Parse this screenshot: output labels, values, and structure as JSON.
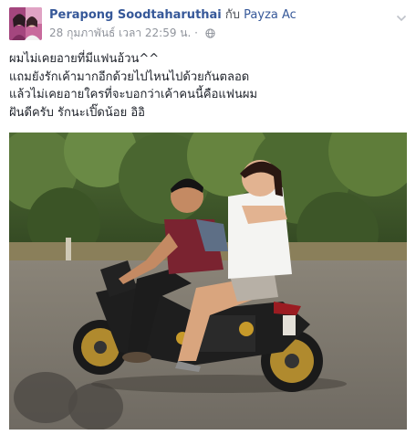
{
  "post": {
    "author": "Perapong Soodtaharuthai",
    "with_word": "กับ",
    "tagged_user": "Payza Ac",
    "timestamp": "28 กุมภาพันธ์ เวลา 22:59 น.",
    "separator": "·",
    "privacy_icon": "globe-icon",
    "menu_icon": "chevron-down-icon",
    "text_lines": [
      "ผมไม่เคยอายที่มีแฟนอ้วน^^",
      "แถมยังรักเค้ามากอีกด้วยไปไหนไปด้วยกันตลอด",
      "แล้วไม่เคยอายใครที่จะบอกว่าเค้าคนนี้คือแฟนผม",
      "ฝันดีครับ รักนะเปิ๊ดน้อย อิอิ"
    ]
  },
  "colors": {
    "link": "#365899",
    "meta": "#90949c",
    "text": "#1d2129"
  }
}
